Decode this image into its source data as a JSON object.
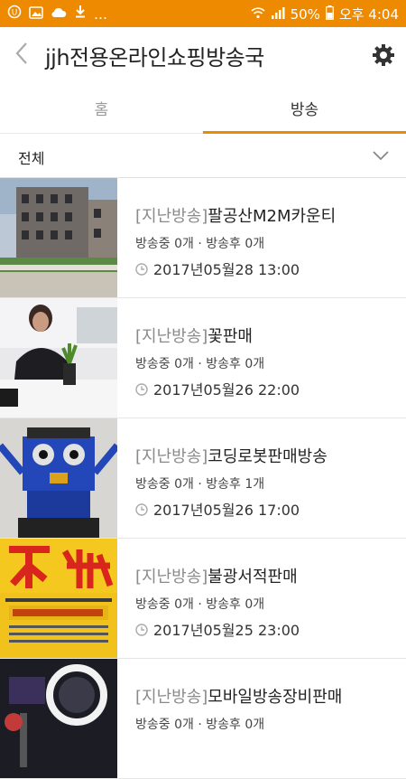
{
  "status_bar": {
    "icons_left": [
      "u-plus-icon",
      "image-icon",
      "cloud-icon",
      "download-icon",
      "more-icon"
    ],
    "ellipsis": "…",
    "battery": "50%",
    "time": "오후 4:04"
  },
  "header": {
    "title": "jjh전용온라인쇼핑방송국"
  },
  "tabs": [
    {
      "label": "홈",
      "active": false
    },
    {
      "label": "방송",
      "active": true
    }
  ],
  "filter": {
    "label": "전체"
  },
  "broadcasts": [
    {
      "tag": "[지난방송]",
      "title": "팔공산M2M카운티",
      "counts": "방송중 0개 · 방송후 0개",
      "date": "2017년05월28 13:00"
    },
    {
      "tag": "[지난방송]",
      "title": "꽃판매",
      "counts": "방송중 0개 · 방송후 0개",
      "date": "2017년05월26 22:00"
    },
    {
      "tag": "[지난방송]",
      "title": "코딩로봇판매방송",
      "counts": "방송중 0개 · 방송후 1개",
      "date": "2017년05월26 17:00"
    },
    {
      "tag": "[지난방송]",
      "title": "불광서적판매",
      "counts": "방송중 0개 · 방송후 0개",
      "date": "2017년05월25 23:00"
    },
    {
      "tag": "[지난방송]",
      "title": "모바일방송장비판매",
      "counts": "방송중 0개 · 방송후 0개",
      "date": ""
    }
  ],
  "colors": {
    "accent": "#ee8a00",
    "tag_gray": "#8a8a8a"
  }
}
